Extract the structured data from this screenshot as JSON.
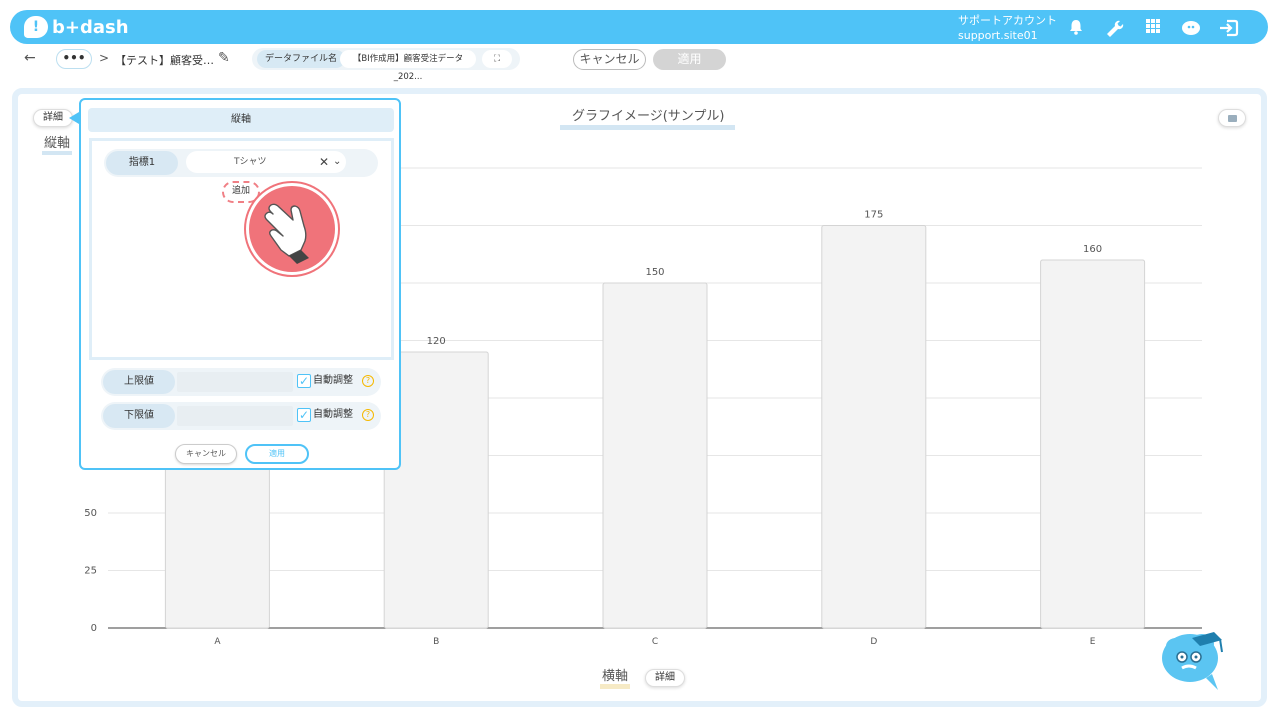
{
  "header": {
    "logo_mark": "!",
    "logo_text": "b+dash",
    "account_label": "サポートアカウント",
    "account_id": "support.site01",
    "icons": [
      "bell-icon",
      "wrench-icon",
      "grid-icon",
      "bird-icon",
      "logout-icon"
    ],
    "accent_color": "#4fc3f7"
  },
  "subbar": {
    "more_label": "•••",
    "separator": ">",
    "breadcrumb_title": "【テスト】顧客受…",
    "file_label": "データファイル名",
    "file_name": "【BI作成用】顧客受注データ_202...",
    "expand_label": "⛶",
    "cancel_label": "キャンセル",
    "apply_label": "適用"
  },
  "chart_area": {
    "title": "グラフイメージ(サンプル)",
    "y_detail_label": "詳細",
    "x_detail_label": "詳細",
    "y_axis_label": "縦軸",
    "x_axis_label": "横軸"
  },
  "popup": {
    "header": "縦軸",
    "metric_label": "指標1",
    "metric_value": "Tシャツ",
    "clear_symbol": "✕",
    "chevron_symbol": "⌄",
    "add_label": "追加",
    "upper_label": "上限値",
    "lower_label": "下限値",
    "auto_label": "自動調整",
    "help_symbol": "?",
    "check_symbol": "✓",
    "cancel_label": "キャンセル",
    "apply_label": "適用"
  },
  "chart_data": {
    "type": "bar",
    "categories": [
      "A",
      "B",
      "C",
      "D",
      "E"
    ],
    "values": [
      null,
      120,
      150,
      175,
      160
    ],
    "title": "グラフイメージ(サンプル)",
    "xlabel": "横軸",
    "ylabel": "縦軸",
    "y_ticks": [
      0,
      25,
      50
    ],
    "ylim": [
      0,
      200
    ],
    "grid": true,
    "bar_color": "#f3f3f3"
  }
}
